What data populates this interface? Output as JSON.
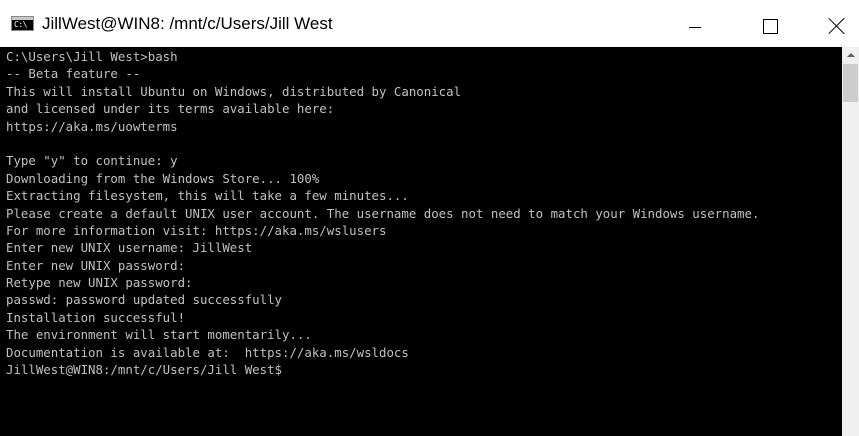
{
  "window": {
    "title": "JillWest@WIN8: /mnt/c/Users/Jill West",
    "app_icon": "command-prompt-icon",
    "app_icon_text": "C:\\",
    "controls": {
      "minimize_icon": "minimize-icon",
      "maximize_icon": "maximize-icon",
      "close_icon": "close-icon"
    }
  },
  "console": {
    "background_color": "#000000",
    "text_color": "#c0c0c0",
    "lines": [
      "C:\\Users\\Jill West>bash",
      "-- Beta feature --",
      "This will install Ubuntu on Windows, distributed by Canonical",
      "and licensed under its terms available here:",
      "https://aka.ms/uowterms",
      "",
      "Type \"y\" to continue: y",
      "Downloading from the Windows Store... 100%",
      "Extracting filesystem, this will take a few minutes...",
      "Please create a default UNIX user account. The username does not need to match your Windows username.",
      "For more information visit: https://aka.ms/wslusers",
      "Enter new UNIX username: JillWest",
      "Enter new UNIX password:",
      "Retype new UNIX password:",
      "passwd: password updated successfully",
      "Installation successful!",
      "The environment will start momentarily...",
      "Documentation is available at:  https://aka.ms/wsldocs",
      "JillWest@WIN8:/mnt/c/Users/Jill West$"
    ]
  },
  "scrollbar": {
    "up_arrow_icon": "scroll-up-arrow-icon"
  }
}
